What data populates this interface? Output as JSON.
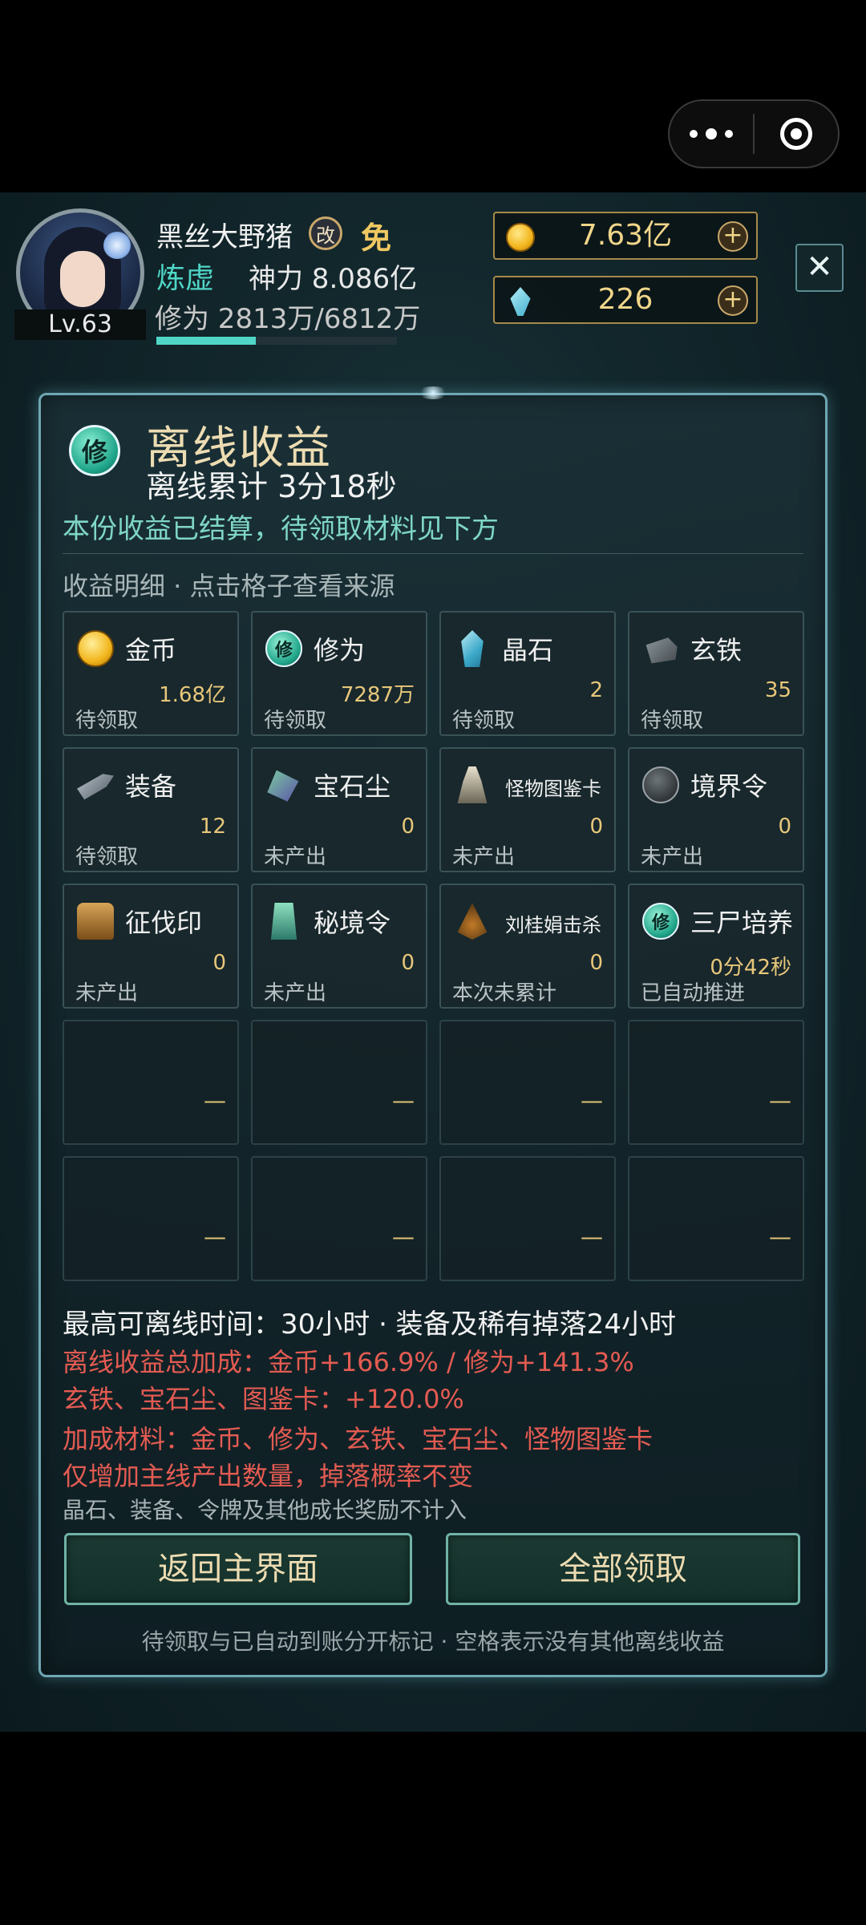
{
  "header": {
    "player_name": "黑丝大野猪",
    "rename_badge": "改",
    "vip_badge": "免",
    "realm": "炼虚",
    "power": "神力 8.086亿",
    "cultivation": "修为 2813万/6812万",
    "cultivation_progress": 0.413,
    "level": "Lv.63",
    "gold": "7.63亿",
    "crystal": "226",
    "close_glyph": "✕",
    "plus_glyph": "+"
  },
  "panel": {
    "icon_text": "修",
    "title": "离线收益",
    "subtitle": "离线累计 3分18秒",
    "notice": "本份收益已结算，待领取材料见下方",
    "detail_head": "收益明细 · 点击格子查看来源"
  },
  "cells": [
    {
      "name": "金币",
      "value": "1.68亿",
      "status": "待领取",
      "icon": "coin-icon"
    },
    {
      "name": "修为",
      "value": "7287万",
      "status": "待领取",
      "icon": "cultivation-icon",
      "icon_text": "修"
    },
    {
      "name": "晶石",
      "value": "2",
      "status": "待领取",
      "icon": "crystal-icon"
    },
    {
      "name": "玄铁",
      "value": "35",
      "status": "待领取",
      "icon": "iron-icon"
    },
    {
      "name": "装备",
      "value": "12",
      "status": "待领取",
      "icon": "equipment-icon"
    },
    {
      "name": "宝石尘",
      "value": "0",
      "status": "未产出",
      "icon": "gem-dust-icon"
    },
    {
      "name": "怪物图鉴卡",
      "value": "0",
      "status": "未产出",
      "icon": "monster-card-icon"
    },
    {
      "name": "境界令",
      "value": "0",
      "status": "未产出",
      "icon": "realm-token-icon"
    },
    {
      "name": "征伐印",
      "value": "0",
      "status": "未产出",
      "icon": "conquest-seal-icon"
    },
    {
      "name": "秘境令",
      "value": "0",
      "status": "未产出",
      "icon": "secret-realm-icon"
    },
    {
      "name": "刘桂娟击杀",
      "value": "0",
      "status": "本次未累计",
      "icon": "kill-icon"
    },
    {
      "name": "三尸培养",
      "value": "0分42秒",
      "status": "已自动推进",
      "icon": "cultivation-icon",
      "icon_text": "修"
    }
  ],
  "empty_cell_mark": "—",
  "info": {
    "line1": "最高可离线时间：30小时 · 装备及稀有掉落24小时",
    "line2": "离线收益总加成：金币+166.9% / 修为+141.3%",
    "line3": "玄铁、宝石尘、图鉴卡：+120.0%",
    "line4": "加成材料：金币、修为、玄铁、宝石尘、怪物图鉴卡",
    "line5": "仅增加主线产出数量，掉落概率不变",
    "line6": "晶石、装备、令牌及其他成长奖励不计入"
  },
  "buttons": {
    "back": "返回主界面",
    "claim": "全部领取"
  },
  "footer_note": "待领取与已自动到账分开标记 · 空格表示没有其他离线收益",
  "colors": {
    "accent_teal": "#4fd6c6",
    "gold_text": "#f0d68a",
    "warning_red": "#e45b52",
    "panel_border": "#6fa7b3"
  }
}
